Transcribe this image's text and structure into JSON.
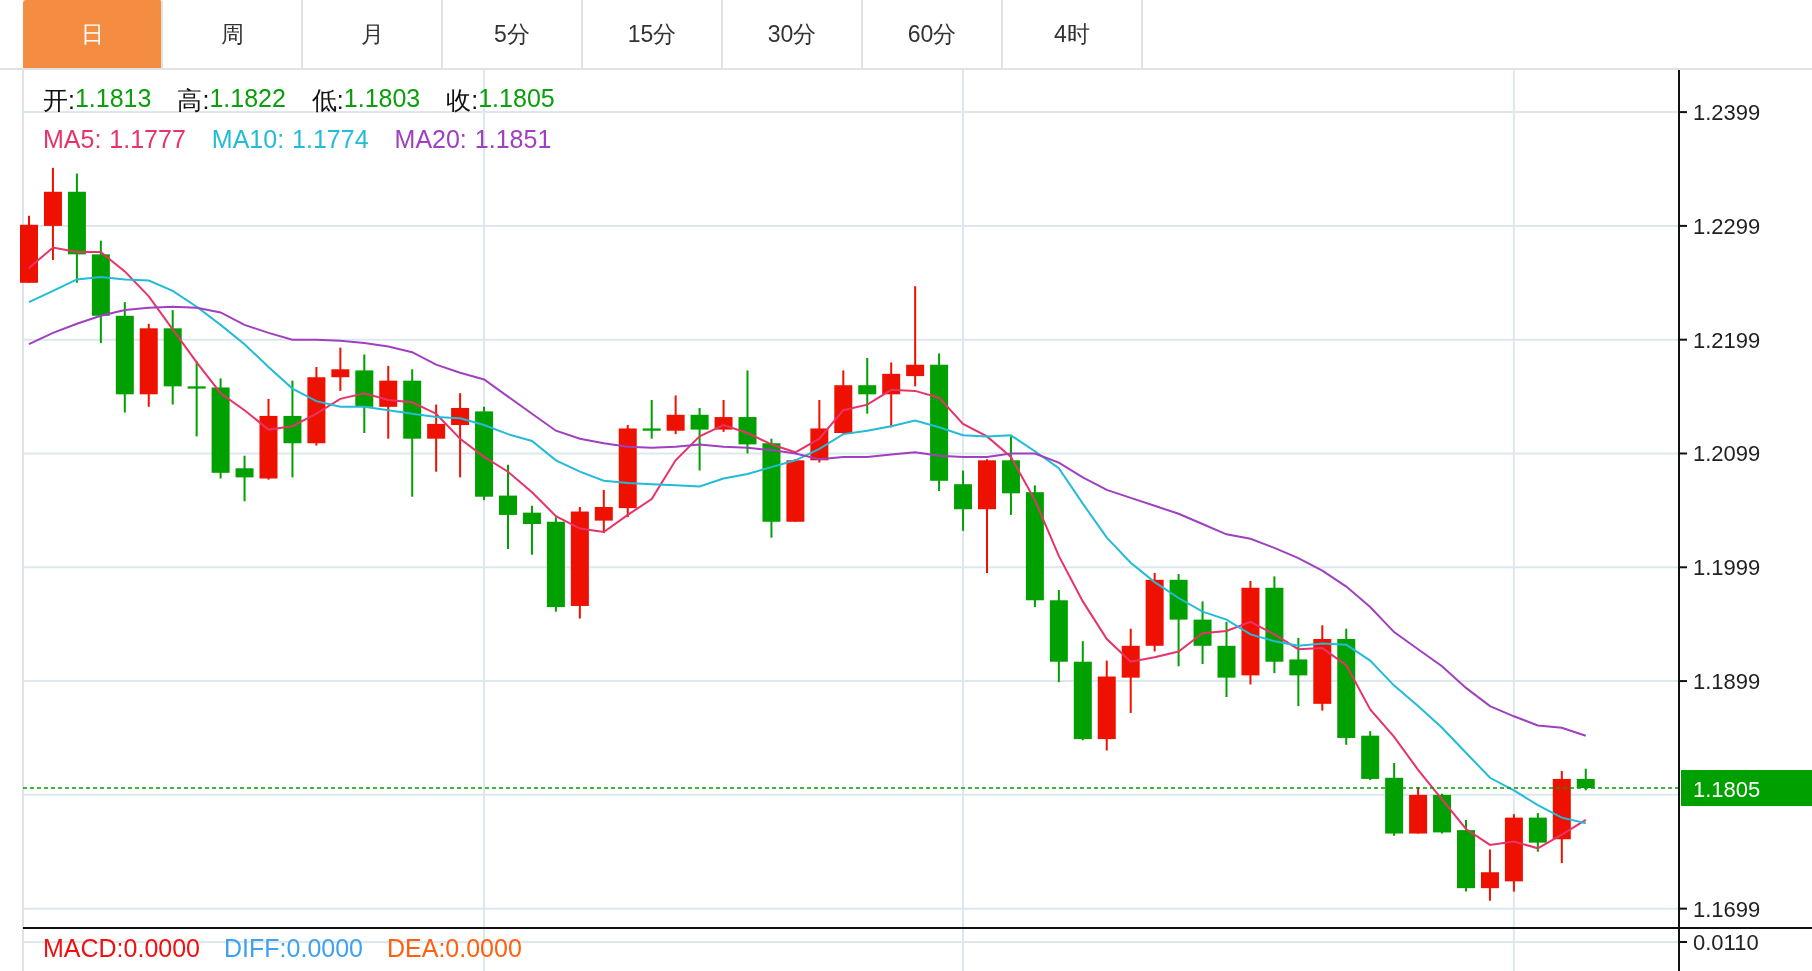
{
  "tabs": [
    {
      "label": "日",
      "selected": true
    },
    {
      "label": "周",
      "selected": false
    },
    {
      "label": "月",
      "selected": false
    },
    {
      "label": "5分",
      "selected": false
    },
    {
      "label": "15分",
      "selected": false
    },
    {
      "label": "30分",
      "selected": false
    },
    {
      "label": "60分",
      "selected": false
    },
    {
      "label": "4时",
      "selected": false
    }
  ],
  "chart": {
    "ohlc": [
      {
        "label": "开:",
        "value": "1.1813"
      },
      {
        "label": "高:",
        "value": "1.1822"
      },
      {
        "label": "低:",
        "value": "1.1803"
      },
      {
        "label": "收:",
        "value": "1.1805"
      }
    ],
    "ma_values": [
      "1.1777",
      "1.1774",
      "1.1851"
    ],
    "chart_data": {
      "type": "line",
      "grid": true,
      "ylim": [
        1.1682,
        1.2436
      ],
      "yticks": [
        1.2399,
        1.2299,
        1.2199,
        1.2099,
        1.1999,
        1.1899,
        1.1699
      ],
      "ref_lines": [
        {
          "axis": "y",
          "value": 1.1805,
          "label": "1.1805"
        }
      ],
      "series": [
        {
          "name": "MA5:",
          "color": "#e8336a",
          "values": [
            1.2262,
            1.228,
            1.2276,
            1.2276,
            1.2259,
            1.2237,
            1.2208,
            1.2179,
            1.2152,
            1.2137,
            1.212,
            1.2123,
            1.2134,
            1.2147,
            1.2152,
            1.2146,
            1.2144,
            1.2134,
            1.2112,
            1.2096,
            1.2083,
            1.2065,
            1.2044,
            1.2033,
            1.203,
            1.2045,
            1.2059,
            1.2093,
            1.2114,
            1.2124,
            1.2117,
            1.2107,
            1.21,
            1.2112,
            1.2137,
            1.2142,
            1.2155,
            1.2154,
            1.2148,
            1.2125,
            1.2114,
            1.2096,
            1.2058,
            1.2009,
            1.1969,
            1.1936,
            1.1916,
            1.192,
            1.1925,
            1.1941,
            1.1943,
            1.1951,
            1.194,
            1.1927,
            1.1928,
            1.1913,
            1.1874,
            1.185,
            1.1821,
            1.1795,
            1.1769,
            1.1755,
            1.1758,
            1.1752,
            1.1764,
            1.1777
          ]
        },
        {
          "name": "MA10:",
          "color": "#22bbd8",
          "values": [
            1.2232,
            1.2242,
            1.2252,
            1.2254,
            1.2252,
            1.2251,
            1.2242,
            1.2228,
            1.2212,
            1.2195,
            1.2175,
            1.2156,
            1.2145,
            1.214,
            1.214,
            1.2137,
            1.2134,
            1.2131,
            1.213,
            1.2124,
            1.2116,
            1.211,
            1.2093,
            1.2083,
            1.2075,
            1.2073,
            1.2072,
            1.2071,
            1.207,
            1.2077,
            1.2081,
            1.2087,
            1.2093,
            1.2103,
            1.2116,
            1.2119,
            1.2123,
            1.2128,
            1.2122,
            1.2115,
            1.2114,
            1.2115,
            1.2101,
            1.2086,
            1.2055,
            1.2025,
            1.2003,
            1.1986,
            1.1972,
            1.196,
            1.1953,
            1.194,
            1.1934,
            1.193,
            1.1932,
            1.1931,
            1.1917,
            1.1895,
            1.1877,
            1.1858,
            1.1836,
            1.1814,
            1.1803,
            1.179,
            1.1779,
            1.1774
          ]
        },
        {
          "name": "MA20:",
          "color": "#a040c0",
          "values": [
            1.2195,
            1.2205,
            1.2213,
            1.222,
            1.2225,
            1.2227,
            1.2228,
            1.2227,
            1.2223,
            1.2212,
            1.2205,
            1.2199,
            1.2199,
            1.2198,
            1.2196,
            1.2193,
            1.2188,
            1.2177,
            1.217,
            1.2164,
            1.2149,
            1.2134,
            1.2119,
            1.2112,
            1.2108,
            1.2105,
            1.2104,
            1.2105,
            1.2107,
            1.2105,
            1.2104,
            1.2102,
            1.2099,
            1.2094,
            1.2096,
            1.2096,
            1.2098,
            1.21,
            1.2097,
            1.2096,
            1.2096,
            1.2099,
            1.2099,
            1.2091,
            1.2078,
            1.2067,
            1.206,
            1.2053,
            1.2046,
            1.2037,
            1.2028,
            1.2024,
            1.2016,
            1.2007,
            1.1996,
            1.1982,
            1.1964,
            1.1942,
            1.1927,
            1.1912,
            1.1893,
            1.1877,
            1.1868,
            1.186,
            1.1858,
            1.1851
          ]
        }
      ]
    }
  },
  "macd": {
    "axis_label": "0.0110",
    "items": [
      {
        "label": "MACD:",
        "value": "0.0000",
        "color": "#f01010"
      },
      {
        "label": "DIFF:",
        "value": "0.0000",
        "color": "#3fa0f0"
      },
      {
        "label": "DEA:",
        "value": "0.0000",
        "color": "#ff6010"
      }
    ]
  }
}
